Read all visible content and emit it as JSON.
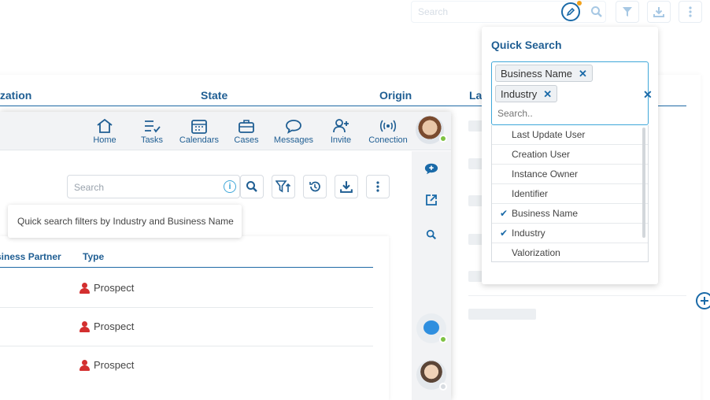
{
  "background": {
    "search_placeholder": "Search",
    "columns": [
      "ization",
      "State",
      "Origin",
      "Las"
    ]
  },
  "quick_search": {
    "title": "Quick Search",
    "chips": [
      "Business Name",
      "Industry"
    ],
    "input_placeholder": "Search..",
    "options": [
      {
        "label": "Last Update User",
        "checked": false
      },
      {
        "label": "Creation User",
        "checked": false
      },
      {
        "label": "Instance Owner",
        "checked": false
      },
      {
        "label": "Identifier",
        "checked": false
      },
      {
        "label": "Business Name",
        "checked": true
      },
      {
        "label": "Industry",
        "checked": true
      },
      {
        "label": "Valorization",
        "checked": false
      }
    ]
  },
  "window": {
    "nav": [
      "Home",
      "Tasks",
      "Calendars",
      "Cases",
      "Messages",
      "Invite",
      "Conection"
    ],
    "search_placeholder": "Search",
    "tooltip": "Quick search filters by Industry and Business Name",
    "table": {
      "columns": [
        "siness Partner",
        "Type"
      ],
      "rows": [
        {
          "type": "Prospect"
        },
        {
          "type": "Prospect"
        },
        {
          "type": "Prospect"
        }
      ]
    }
  },
  "colors": {
    "accent": "#1f5e93",
    "link": "#1a6aa8",
    "prospect_icon": "#d32f2f",
    "online": "#7ec243"
  }
}
